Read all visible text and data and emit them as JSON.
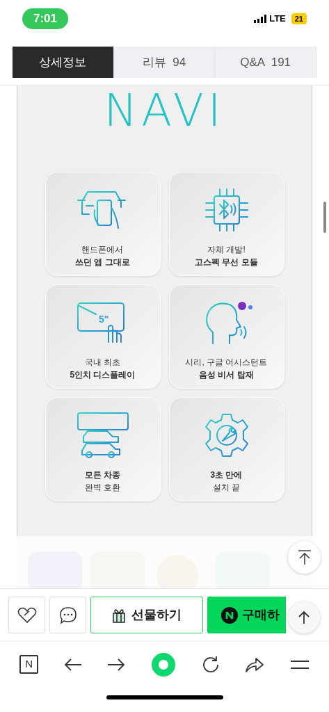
{
  "status_bar": {
    "time": "7:01",
    "network": "LTE",
    "battery": "21"
  },
  "tabs": [
    {
      "label": "상세정보",
      "selected": true
    },
    {
      "label": "리뷰  94",
      "selected": false
    },
    {
      "label": "Q&A  191",
      "selected": false
    }
  ],
  "logo_text": "NAVI",
  "features": [
    {
      "lines": [
        {
          "text": "핸드폰에서",
          "bold": false
        },
        {
          "text": "쓰던 앱 그대로",
          "bold": true
        }
      ]
    },
    {
      "lines": [
        {
          "text": "자체 개발!",
          "bold": false
        },
        {
          "text": "고스펙 무선 모듈",
          "bold": true
        }
      ]
    },
    {
      "lines": [
        {
          "text": "국내 최초",
          "bold": false
        },
        {
          "text": "5인치 디스플레이",
          "bold": true
        }
      ]
    },
    {
      "lines": [
        {
          "text": "시리, 구글 어시스턴트",
          "bold": false
        },
        {
          "text": "음성 비서 탑재",
          "bold": true
        }
      ]
    },
    {
      "lines": [
        {
          "text": "모든 차종",
          "bold": true
        },
        {
          "text": "완벽 호환",
          "bold": false
        }
      ]
    },
    {
      "lines": [
        {
          "text": "3초 만에",
          "bold": true
        },
        {
          "text": "설치 끝",
          "bold": false
        }
      ]
    }
  ],
  "screen_label": "5\"",
  "actions": {
    "gift": "선물하기",
    "buy": "구매하"
  },
  "browser_bar": {
    "logo": "N"
  }
}
